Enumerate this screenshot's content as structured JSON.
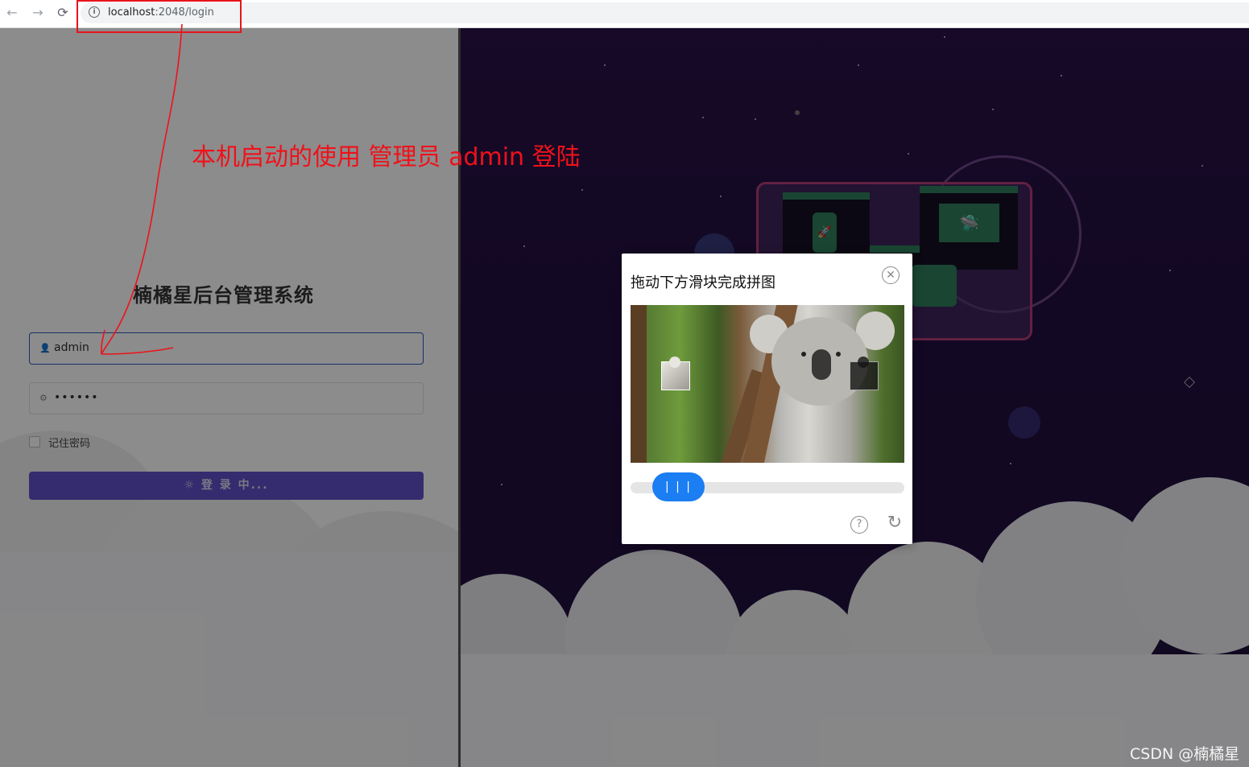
{
  "browser": {
    "back": "←",
    "forward": "→",
    "reload": "⟳",
    "host": "localhost",
    "path": ":2048/login"
  },
  "annotation": "本机启动的使用 管理员 admin 登陆",
  "login": {
    "title": "楠橘星后台管理系统",
    "username": "admin",
    "password": "••••••",
    "remember_label": "记住密码",
    "button_label": "☼ 登 录 中..."
  },
  "captcha": {
    "title": "拖动下方滑块完成拼图",
    "close": "✕",
    "slider_handle": "| | |",
    "help": "?",
    "refresh": "↻"
  },
  "watermark": "CSDN @楠橘星",
  "colors": {
    "annotation_red": "#f0111a",
    "slider_blue": "#1b7ef2",
    "login_button": "#5f50c8"
  }
}
